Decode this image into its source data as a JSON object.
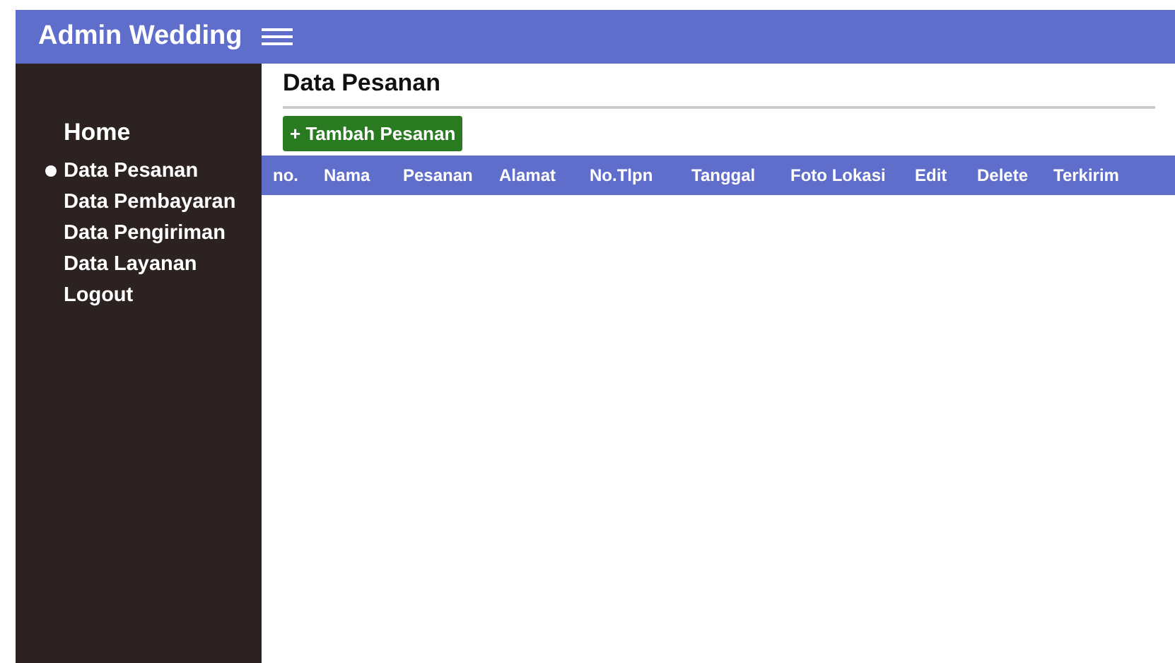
{
  "header": {
    "title": "Admin Wedding"
  },
  "sidebar": {
    "items": [
      {
        "label": "Home",
        "kind": "heading",
        "selected": false
      },
      {
        "label": "Data Pesanan",
        "kind": "link",
        "selected": true
      },
      {
        "label": "Data Pembayaran",
        "kind": "link",
        "selected": false
      },
      {
        "label": "Data Pengiriman",
        "kind": "link",
        "selected": false
      },
      {
        "label": "Data Layanan",
        "kind": "link",
        "selected": false
      },
      {
        "label": "Logout",
        "kind": "link",
        "selected": false
      }
    ]
  },
  "page": {
    "title": "Data Pesanan",
    "add_button": "+ Tambah Pesanan"
  },
  "table": {
    "columns": [
      "no.",
      "Nama",
      "Pesanan",
      "Alamat",
      "No.Tlpn",
      "Tanggal",
      "Foto Lokasi",
      "Edit",
      "Delete",
      "Terkirim"
    ]
  }
}
